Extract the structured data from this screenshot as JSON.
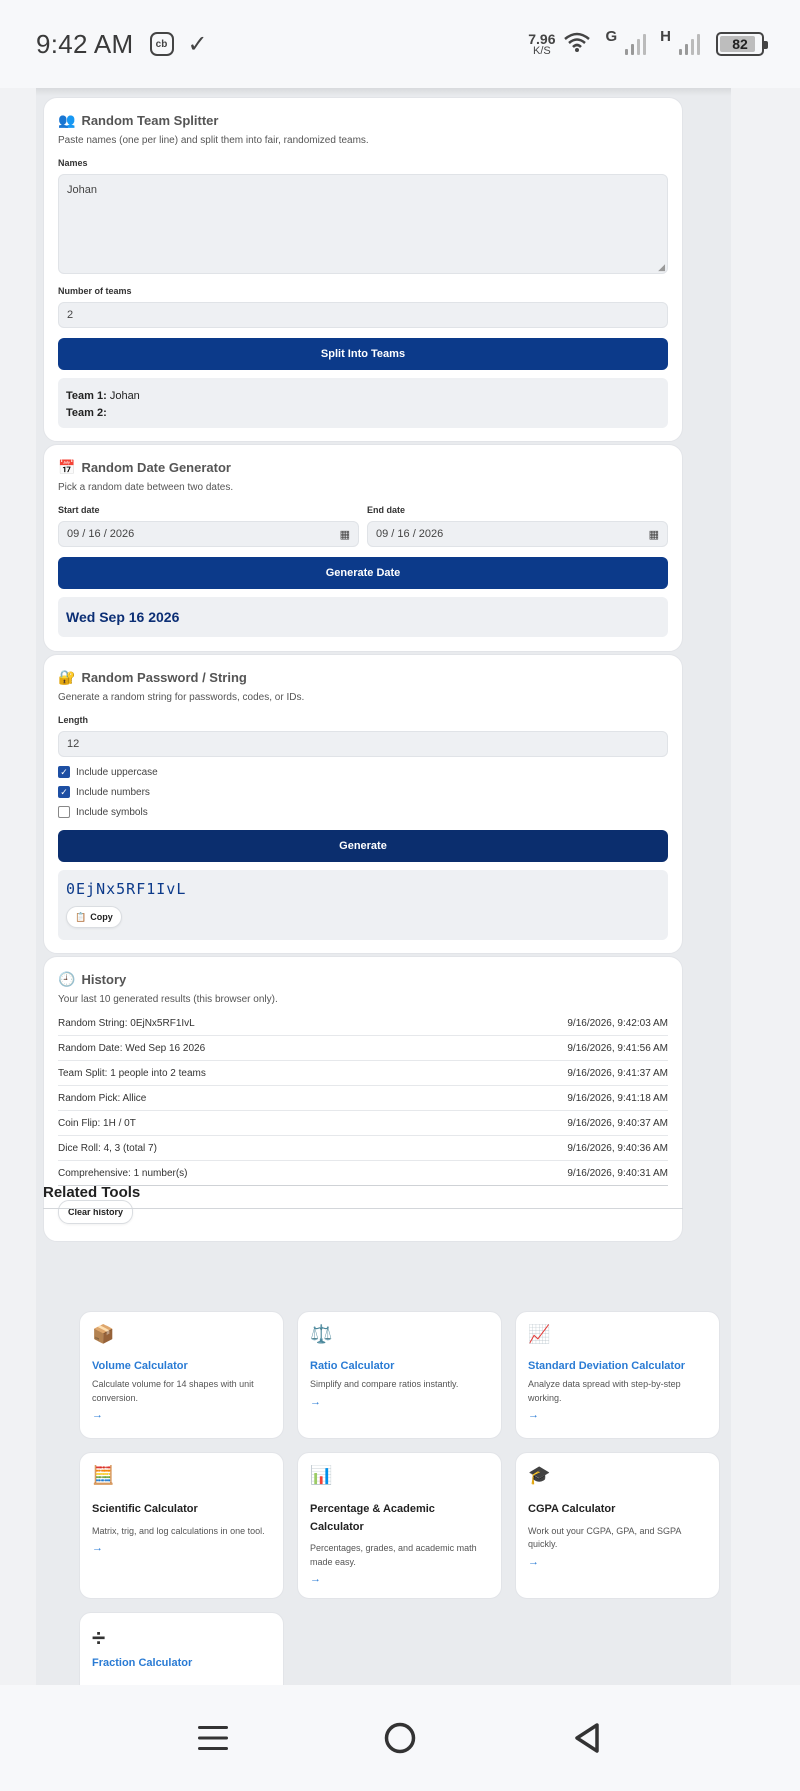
{
  "status": {
    "time": "9:42 AM",
    "speed_value": "7.96",
    "speed_unit": "K/S",
    "net1": "G",
    "net2": "H",
    "battery": "82"
  },
  "team_splitter": {
    "icon": "people-icon",
    "title": "Random Team Splitter",
    "desc": "Paste names (one per line) and split them into fair, randomized teams.",
    "names_label": "Names",
    "names_value": "Johan",
    "teams_label": "Number of teams",
    "teams_value": "2",
    "button": "Split Into Teams",
    "result": [
      {
        "label": "Team 1:",
        "value": "Johan"
      },
      {
        "label": "Team 2:",
        "value": ""
      }
    ]
  },
  "date_generator": {
    "icon": "calendar-icon",
    "title": "Random Date Generator",
    "desc": "Pick a random date between two dates.",
    "start_label": "Start date",
    "start_value": "09 / 16 / 2026",
    "end_label": "End date",
    "end_value": "09 / 16 / 2026",
    "button": "Generate Date",
    "result": "Wed Sep 16 2026"
  },
  "password": {
    "icon": "lock-key-icon",
    "title": "Random Password / String",
    "desc": "Generate a random string for passwords, codes, or IDs.",
    "length_label": "Length",
    "length_value": "12",
    "options": [
      {
        "label": "Include uppercase",
        "checked": true
      },
      {
        "label": "Include numbers",
        "checked": true
      },
      {
        "label": "Include symbols",
        "checked": false
      }
    ],
    "button": "Generate",
    "result": "0EjNx5RF1IvL",
    "copy": "Copy"
  },
  "history": {
    "icon": "clock-icon",
    "title": "History",
    "desc": "Your last 10 generated results (this browser only).",
    "rows": [
      {
        "text": "Random String: 0EjNx5RF1IvL",
        "time": "9/16/2026, 9:42:03 AM"
      },
      {
        "text": "Random Date: Wed Sep 16 2026",
        "time": "9/16/2026, 9:41:56 AM"
      },
      {
        "text": "Team Split: 1 people into 2 teams",
        "time": "9/16/2026, 9:41:37 AM"
      },
      {
        "text": "Random Pick: Allice",
        "time": "9/16/2026, 9:41:18 AM"
      },
      {
        "text": "Coin Flip: 1H / 0T",
        "time": "9/16/2026, 9:40:37 AM"
      },
      {
        "text": "Dice Roll: 4, 3 (total 7)",
        "time": "9/16/2026, 9:40:36 AM"
      },
      {
        "text": "Comprehensive: 1 number(s)",
        "time": "9/16/2026, 9:40:31 AM"
      }
    ],
    "clear": "Clear history"
  },
  "related": {
    "title": "Related Tools",
    "tools": [
      {
        "icon": "package-icon",
        "name": "Volume Calculator",
        "desc": "Calculate volume for 14 shapes with unit conversion.",
        "arrow": "→"
      },
      {
        "icon": "scales-icon",
        "name": "Ratio Calculator",
        "desc": "Simplify and compare ratios instantly.",
        "arrow": "→"
      },
      {
        "icon": "chart-up-icon",
        "name": "Standard Deviation Calculator",
        "desc": "Analyze data spread with step-by-step working.",
        "arrow": "→"
      },
      {
        "icon": "abacus-icon",
        "name": "Scientific Calculator",
        "desc": "Matrix, trig, and log calculations in one tool.",
        "arrow": "→"
      },
      {
        "icon": "bar-chart-icon",
        "name": "Percentage & Academic Calculator",
        "desc": "Percentages, grades, and academic math made easy.",
        "arrow": "→"
      },
      {
        "icon": "grad-cap-icon",
        "name": "CGPA Calculator",
        "desc": "Work out your CGPA, GPA, and SGPA quickly.",
        "arrow": "→"
      },
      {
        "icon": "divide-icon",
        "name": "Fraction Calculator",
        "desc": "",
        "arrow": ""
      }
    ]
  },
  "colors": {
    "primary": "#0c3a8a",
    "link": "#2a7bd4",
    "result_date": "#0c2f75"
  }
}
